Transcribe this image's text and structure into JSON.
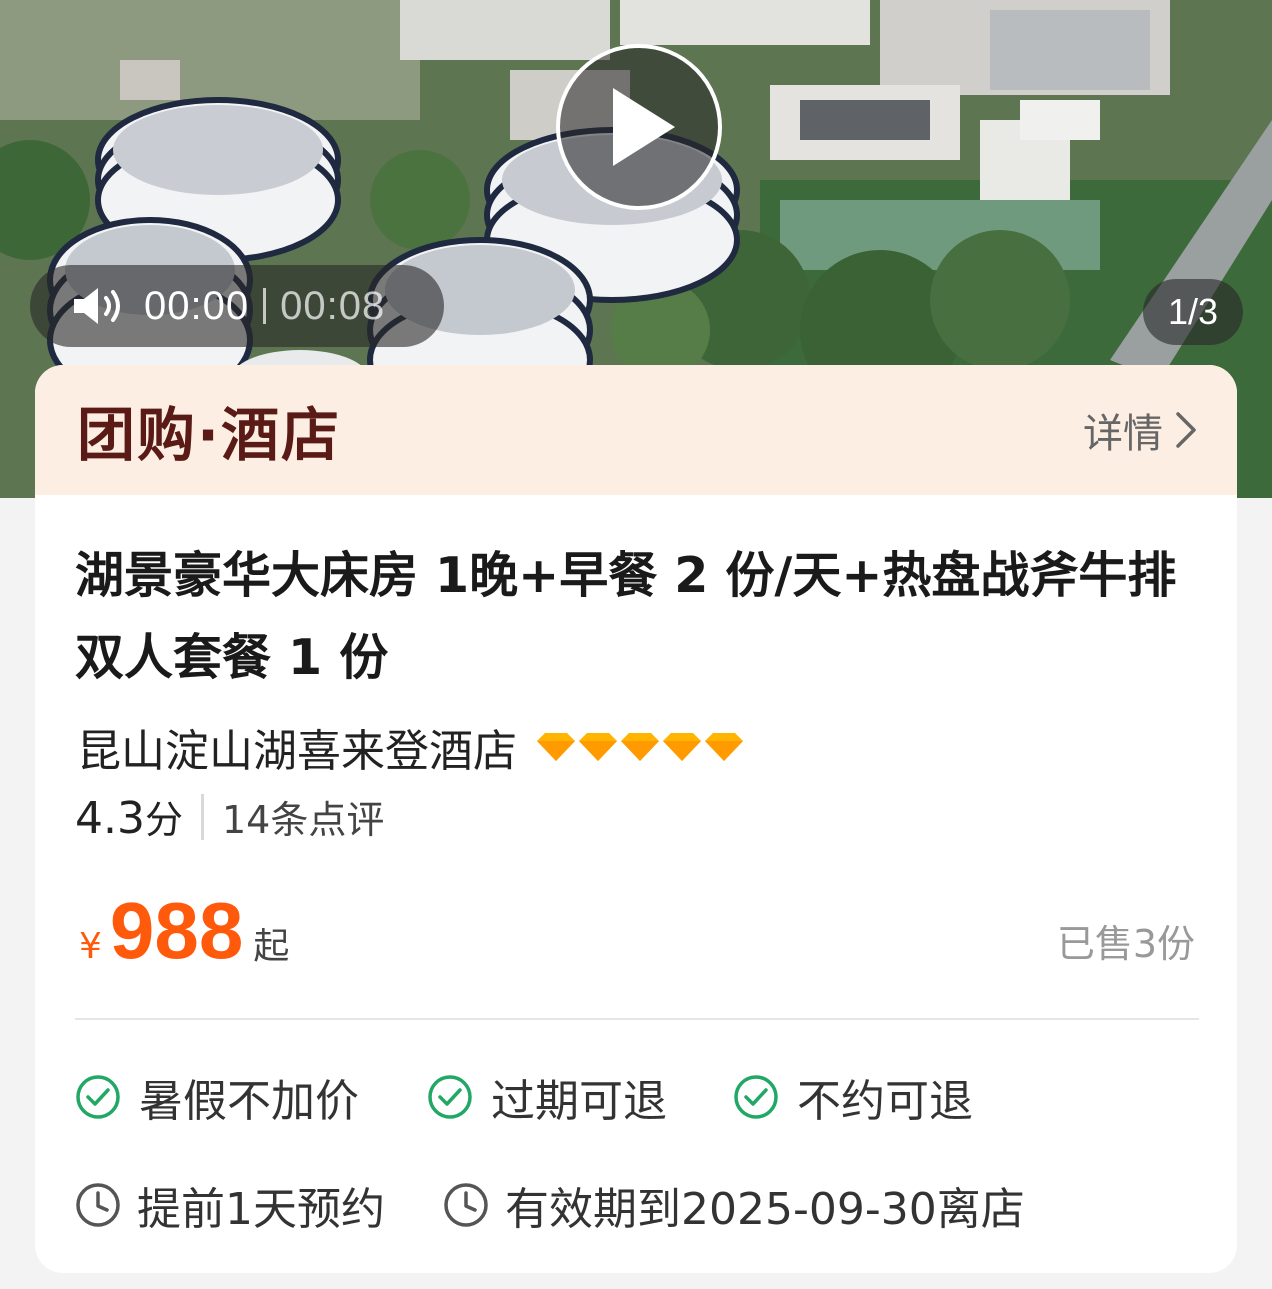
{
  "video": {
    "current_time": "00:00",
    "duration": "00:08",
    "page_indicator": "1/3"
  },
  "card": {
    "tag": "团购·酒店",
    "detail_label": "详情",
    "title": "湖景豪华大床房 1晚+早餐 2 份/天+热盘战斧牛排双人套餐 1 份",
    "hotel_name": "昆山淀山湖喜来登酒店",
    "diamond_rating": 5,
    "score": "4.3",
    "score_unit": "分",
    "reviews": "14条点评",
    "price": {
      "currency": "¥",
      "amount": "988",
      "suffix": "起"
    },
    "sold": "已售3份",
    "features": [
      "暑假不加价",
      "过期可退",
      "不约可退"
    ],
    "info": [
      "提前1天预约",
      "有效期到2025-09-30离店"
    ]
  },
  "colors": {
    "price": "#ff5a0b",
    "header_bg": "#fdeee4",
    "tag_text": "#5a1b17",
    "check_green": "#22a866",
    "diamond": "#ffb400"
  }
}
